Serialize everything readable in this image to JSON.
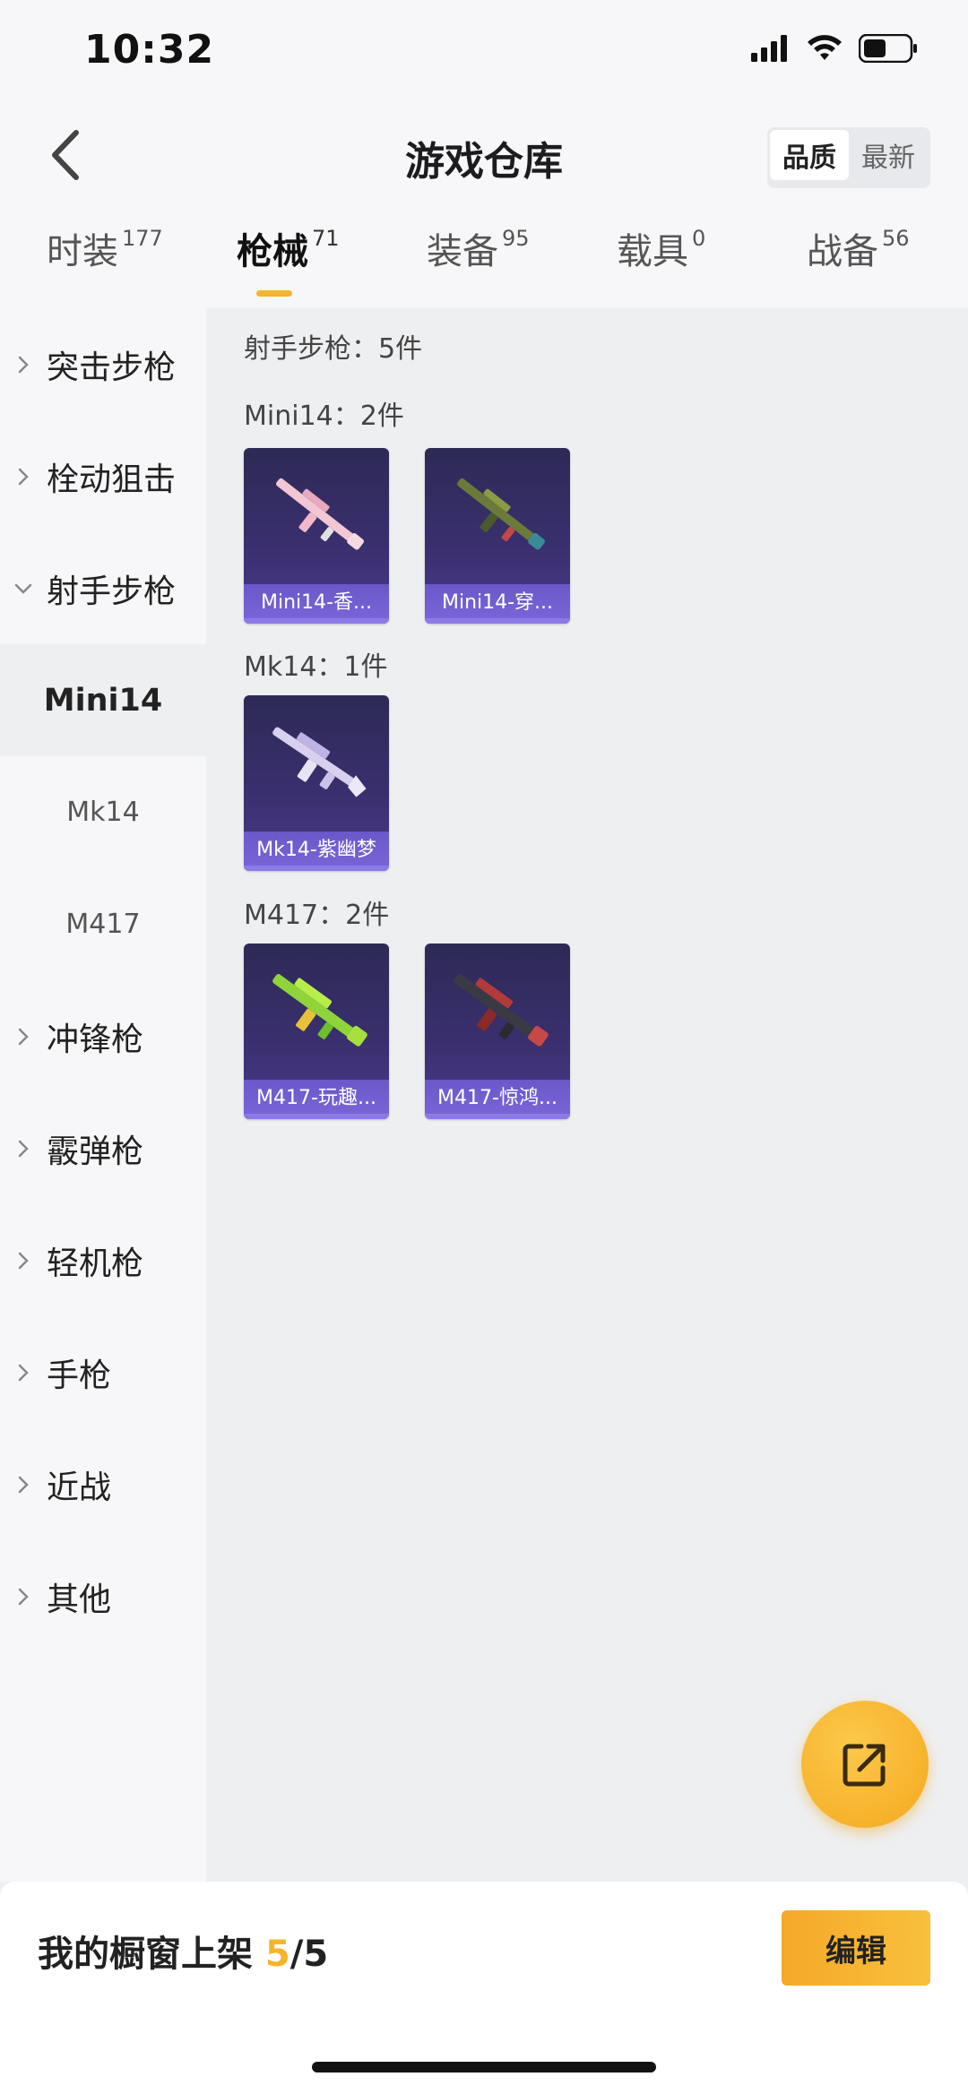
{
  "status_bar": {
    "time": "10:32"
  },
  "header": {
    "title": "游戏仓库",
    "sort_options": [
      "品质",
      "最新"
    ]
  },
  "tabs": [
    {
      "label": "时装",
      "count": "177"
    },
    {
      "label": "枪械",
      "count": "71"
    },
    {
      "label": "装备",
      "count": "95"
    },
    {
      "label": "载具",
      "count": "0"
    },
    {
      "label": "战备",
      "count": "56"
    }
  ],
  "sidebar": {
    "categories": [
      "突击步枪",
      "栓动狙击",
      "射手步枪",
      "冲锋枪",
      "霰弹枪",
      "轻机枪",
      "手枪",
      "近战",
      "其他"
    ],
    "subitems": [
      "Mini14",
      "Mk14",
      "M417"
    ]
  },
  "content": {
    "section_title": "射手步枪：5件",
    "groups": [
      {
        "title": "Mini14：2件",
        "items": [
          "Mini14-香...",
          "Mini14-穿..."
        ]
      },
      {
        "title": "Mk14：1件",
        "items": [
          "Mk14-紫幽梦"
        ]
      },
      {
        "title": "M417：2件",
        "items": [
          "M417-玩趣...",
          "M417-惊鸿..."
        ]
      }
    ]
  },
  "bottom": {
    "label": "我的橱窗上架",
    "count_current": "5",
    "count_total": "/5",
    "edit_label": "编辑"
  },
  "colors": {
    "accent": "#f5b52a",
    "card_bg": "#3a2f6e",
    "card_label": "#7b66d8"
  }
}
